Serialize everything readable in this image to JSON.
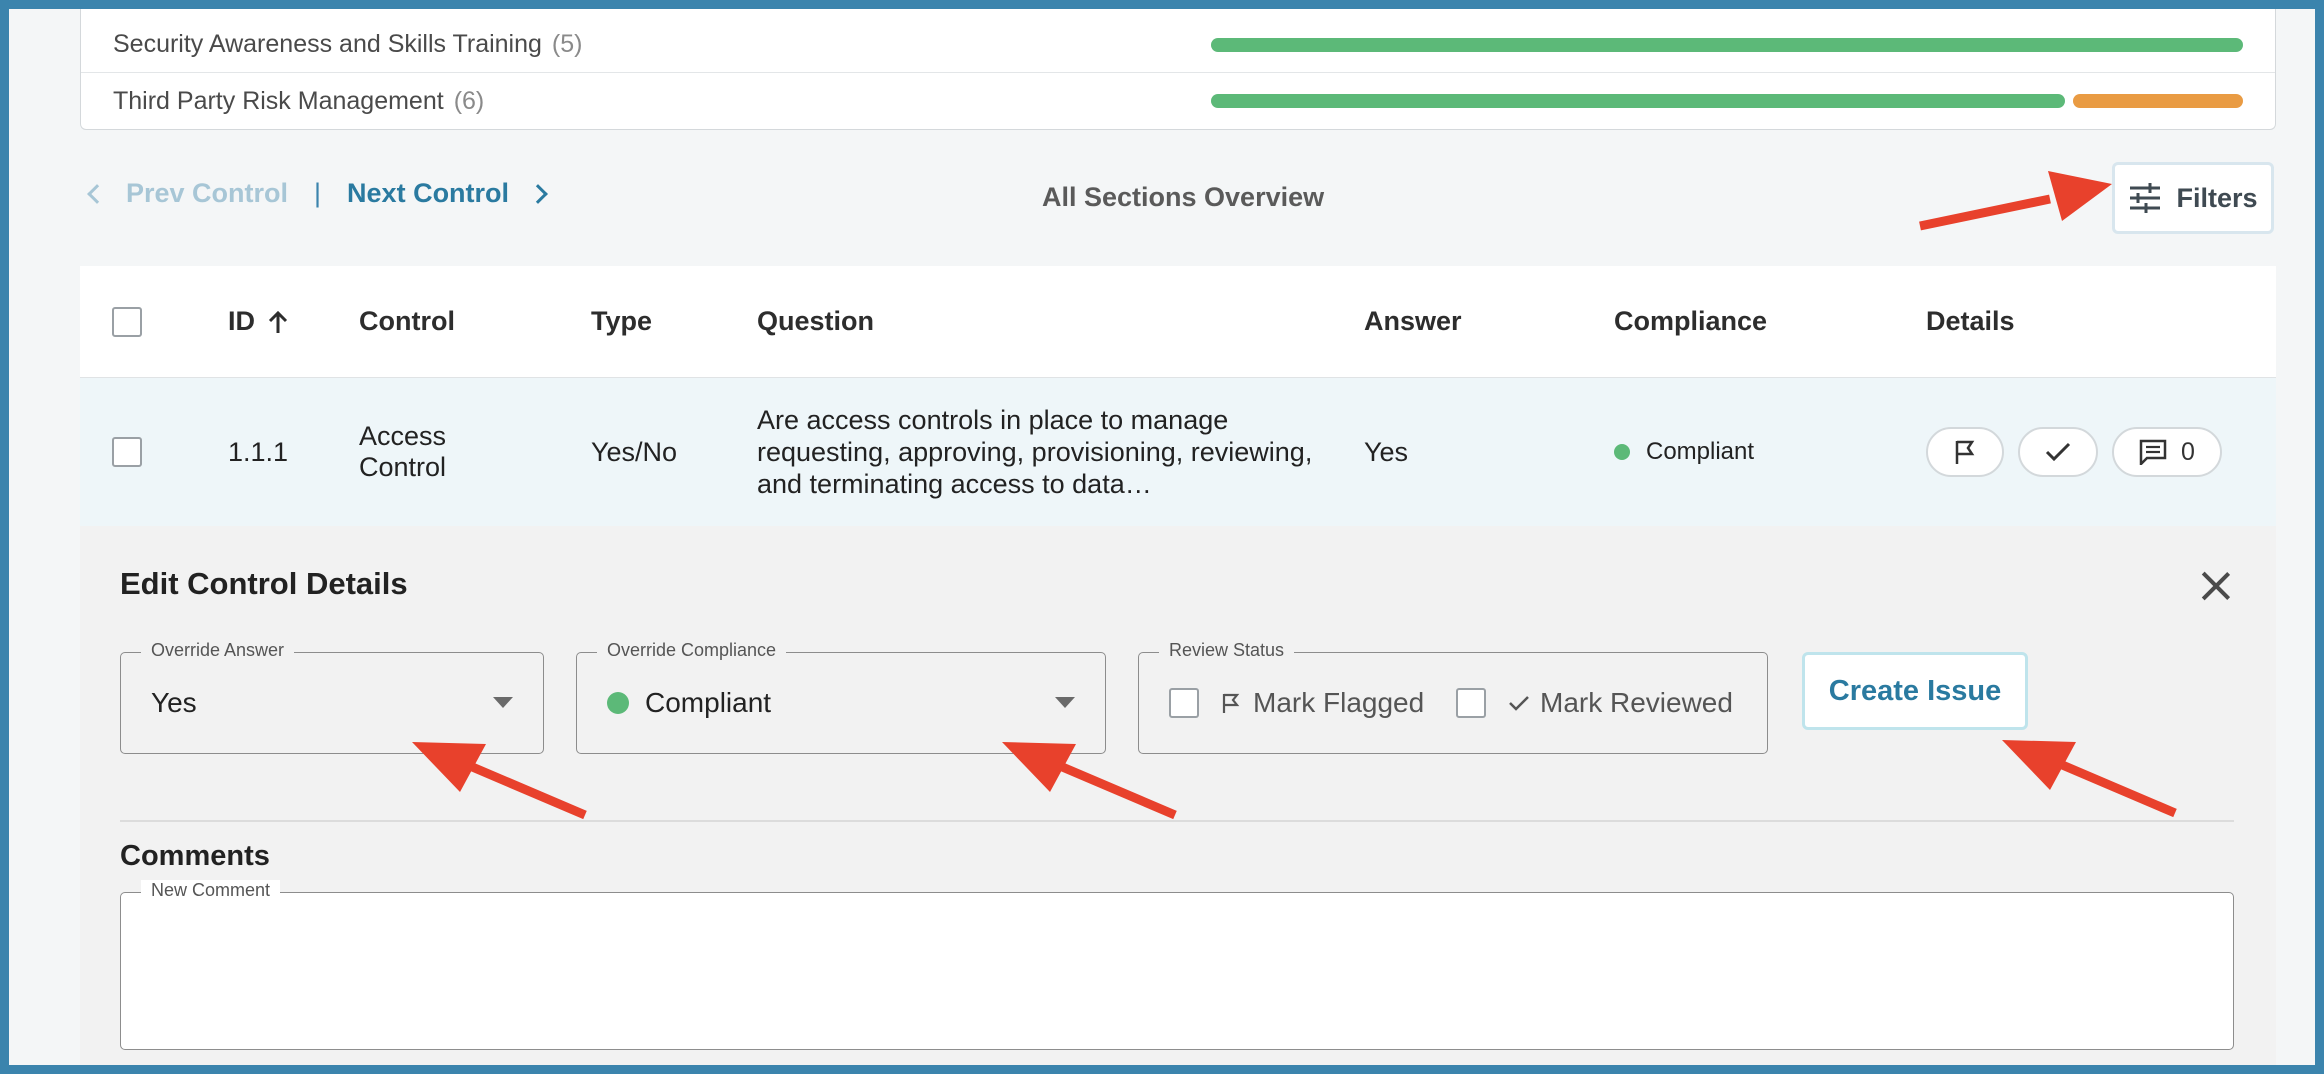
{
  "sections": [
    {
      "name": "Security Awareness and Skills Training",
      "count": "(5)",
      "progress": {
        "compliant": 1.0,
        "non_compliant": 0.0
      }
    },
    {
      "name": "Third Party Risk Management",
      "count": "(6)",
      "progress": {
        "compliant": 0.83,
        "non_compliant": 0.17
      }
    }
  ],
  "nav": {
    "prev_label": "Prev Control",
    "separator": "|",
    "next_label": "Next Control",
    "overview": "All Sections Overview",
    "filters_label": "Filters"
  },
  "table": {
    "headers": {
      "id": "ID",
      "control": "Control",
      "type": "Type",
      "question": "Question",
      "answer": "Answer",
      "compliance": "Compliance",
      "details": "Details"
    },
    "row": {
      "id": "1.1.1",
      "control": "Access Control",
      "type": "Yes/No",
      "question": "Are access controls in place to manage requesting, approving, provisioning, reviewing, and terminating access to data…",
      "answer": "Yes",
      "compliance": "Compliant",
      "comment_count": "0"
    }
  },
  "edit": {
    "title": "Edit Control Details",
    "override_answer_legend": "Override Answer",
    "override_answer_value": "Yes",
    "override_compliance_legend": "Override Compliance",
    "override_compliance_value": "Compliant",
    "review_status_legend": "Review Status",
    "mark_flagged": "Mark Flagged",
    "mark_reviewed": "Mark Reviewed",
    "create_issue": "Create Issue",
    "comments_title": "Comments",
    "new_comment_legend": "New Comment"
  },
  "colors": {
    "accent": "#2a7aa0",
    "compliant": "#5cb978",
    "non_compliant": "#e99b43",
    "annotation_arrow": "#e8412c",
    "frame": "#3b84ad"
  },
  "icons": [
    "chevron-left-icon",
    "chevron-right-icon",
    "sort-up-icon",
    "filters-icon",
    "flag-icon",
    "check-icon",
    "comment-icon",
    "close-icon",
    "caret-down-icon"
  ]
}
